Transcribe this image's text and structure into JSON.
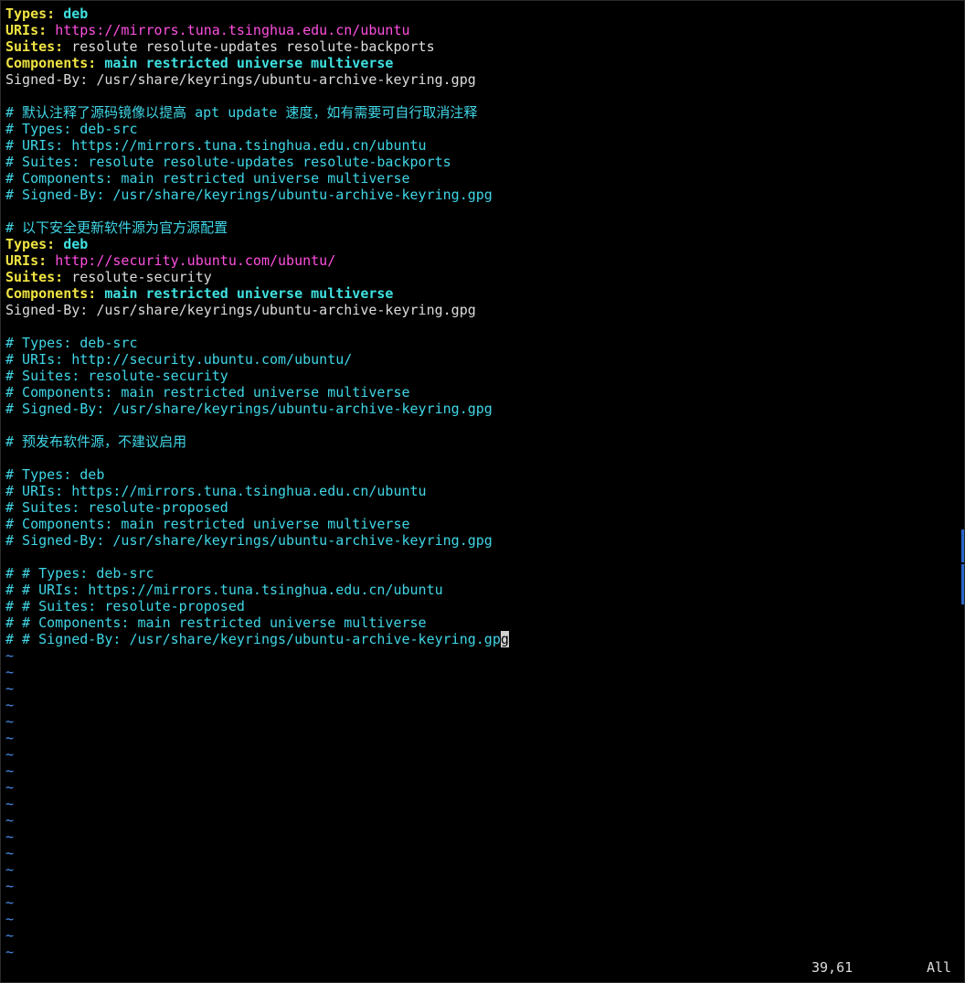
{
  "editor": {
    "lines": [
      [
        {
          "t": "Types:",
          "c": "key"
        },
        {
          "t": " "
        },
        {
          "t": "deb",
          "c": "kw"
        }
      ],
      [
        {
          "t": "URIs:",
          "c": "key"
        },
        {
          "t": " "
        },
        {
          "t": "https://mirrors.tuna.tsinghua.edu.cn/ubuntu",
          "c": "url"
        }
      ],
      [
        {
          "t": "Suites:",
          "c": "key"
        },
        {
          "t": " resolute resolute-updates resolute-backports",
          "c": "plain"
        }
      ],
      [
        {
          "t": "Components:",
          "c": "key"
        },
        {
          "t": " "
        },
        {
          "t": "main restricted universe multiverse",
          "c": "kw"
        }
      ],
      [
        {
          "t": "Signed-By: /usr/share/keyrings/ubuntu-archive-keyring.gpg",
          "c": "plain"
        }
      ],
      [],
      [
        {
          "t": "# 默认注释了源码镜像以提高 apt update 速度，如有需要可自行取消注释",
          "c": "comment"
        }
      ],
      [
        {
          "t": "# Types: deb-src",
          "c": "comment"
        }
      ],
      [
        {
          "t": "# URIs: https://mirrors.tuna.tsinghua.edu.cn/ubuntu",
          "c": "comment"
        }
      ],
      [
        {
          "t": "# Suites: resolute resolute-updates resolute-backports",
          "c": "comment"
        }
      ],
      [
        {
          "t": "# Components: main restricted universe multiverse",
          "c": "comment"
        }
      ],
      [
        {
          "t": "# Signed-By: /usr/share/keyrings/ubuntu-archive-keyring.gpg",
          "c": "comment"
        }
      ],
      [],
      [
        {
          "t": "# 以下安全更新软件源为官方源配置",
          "c": "comment"
        }
      ],
      [
        {
          "t": "Types:",
          "c": "key"
        },
        {
          "t": " "
        },
        {
          "t": "deb",
          "c": "kw"
        }
      ],
      [
        {
          "t": "URIs:",
          "c": "key"
        },
        {
          "t": " "
        },
        {
          "t": "http://security.ubuntu.com/ubuntu/",
          "c": "url"
        }
      ],
      [
        {
          "t": "Suites:",
          "c": "key"
        },
        {
          "t": " resolute-security",
          "c": "plain"
        }
      ],
      [
        {
          "t": "Components:",
          "c": "key"
        },
        {
          "t": " "
        },
        {
          "t": "main restricted universe multiverse",
          "c": "kw"
        }
      ],
      [
        {
          "t": "Signed-By: /usr/share/keyrings/ubuntu-archive-keyring.gpg",
          "c": "plain"
        }
      ],
      [],
      [
        {
          "t": "# Types: deb-src",
          "c": "comment"
        }
      ],
      [
        {
          "t": "# URIs: http://security.ubuntu.com/ubuntu/",
          "c": "comment"
        }
      ],
      [
        {
          "t": "# Suites: resolute-security",
          "c": "comment"
        }
      ],
      [
        {
          "t": "# Components: main restricted universe multiverse",
          "c": "comment"
        }
      ],
      [
        {
          "t": "# Signed-By: /usr/share/keyrings/ubuntu-archive-keyring.gpg",
          "c": "comment"
        }
      ],
      [],
      [
        {
          "t": "# 预发布软件源，不建议启用",
          "c": "comment"
        }
      ],
      [],
      [
        {
          "t": "# Types: deb",
          "c": "comment"
        }
      ],
      [
        {
          "t": "# URIs: https://mirrors.tuna.tsinghua.edu.cn/ubuntu",
          "c": "comment"
        }
      ],
      [
        {
          "t": "# Suites: resolute-proposed",
          "c": "comment"
        }
      ],
      [
        {
          "t": "# Components: main restricted universe multiverse",
          "c": "comment"
        }
      ],
      [
        {
          "t": "# Signed-By: /usr/share/keyrings/ubuntu-archive-keyring.gpg",
          "c": "comment"
        }
      ],
      [],
      [
        {
          "t": "# # Types: deb-src",
          "c": "comment"
        }
      ],
      [
        {
          "t": "# # URIs: https://mirrors.tuna.tsinghua.edu.cn/ubuntu",
          "c": "comment"
        }
      ],
      [
        {
          "t": "# # Suites: resolute-proposed",
          "c": "comment"
        }
      ],
      [
        {
          "t": "# # Components: main restricted universe multiverse",
          "c": "comment"
        }
      ],
      [
        {
          "t": "# # Signed-By: /usr/share/keyrings/ubuntu-archive-keyring.gp",
          "c": "comment"
        },
        {
          "t": "g",
          "c": "cursor"
        }
      ]
    ],
    "tilde_char": "~",
    "tilde_count": 19
  },
  "status": {
    "position": "39,61",
    "scroll": "All"
  },
  "colors": {
    "background": "#000000",
    "key": "#f0e442",
    "keyword": "#3fe0e0",
    "url": "#ff4fe0",
    "comment": "#3fd6e6",
    "plain": "#dcdcdc",
    "tilde": "#4a8ff0"
  }
}
